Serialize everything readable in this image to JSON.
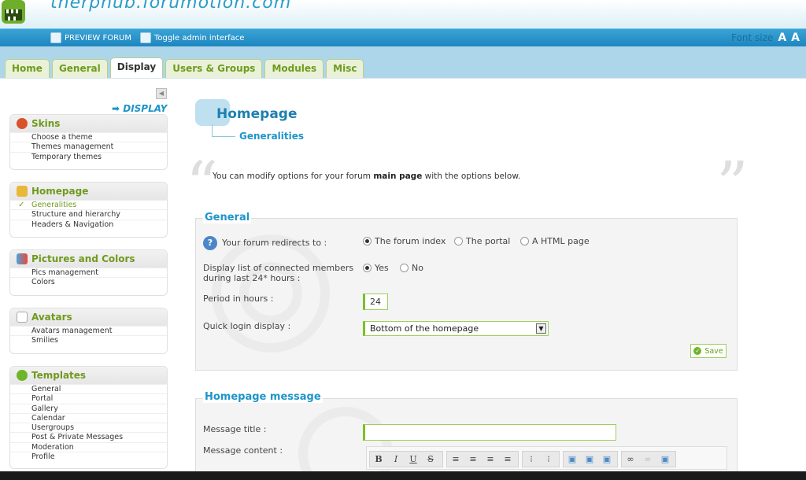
{
  "header": {
    "site_title": "therphub.forumotion.com",
    "preview_label": "PREVIEW FORUM",
    "toggle_label": "Toggle admin interface",
    "font_size_label": "Font size"
  },
  "tabs": [
    {
      "label": "Home"
    },
    {
      "label": "General"
    },
    {
      "label": "Display"
    },
    {
      "label": "Users & Groups"
    },
    {
      "label": "Modules"
    },
    {
      "label": "Misc"
    }
  ],
  "sidebar": {
    "section_label": "➡ DISPLAY",
    "skins": {
      "title": "Skins",
      "items": [
        "Choose a theme",
        "Themes management",
        "Temporary themes"
      ]
    },
    "homepage": {
      "title": "Homepage",
      "items": [
        "Generalities",
        "Structure and hierarchy",
        "Headers & Navigation"
      ]
    },
    "pictures": {
      "title": "Pictures and Colors",
      "items": [
        "Pics management",
        "Colors"
      ]
    },
    "avatars": {
      "title": "Avatars",
      "items": [
        "Avatars management",
        "Smilies"
      ]
    },
    "templates": {
      "title": "Templates",
      "items": [
        "General",
        "Portal",
        "Gallery",
        "Calendar",
        "Usergroups",
        "Post & Private Messages",
        "Moderation",
        "Profile"
      ]
    }
  },
  "main": {
    "title": "Homepage",
    "subtitle": "Generalities",
    "intro_pre": "You can modify options for your forum ",
    "intro_bold": "main page",
    "intro_post": " with the options below.",
    "general": {
      "title": "General",
      "redirect_label": "Your forum redirects to :",
      "redirect_options": [
        "The forum index",
        "The portal",
        "A HTML page"
      ],
      "connected_label_1": "Display list of connected members",
      "connected_label_2": "during last 24* hours :",
      "connected_options": [
        "Yes",
        "No"
      ],
      "period_label": "Period in hours :",
      "period_value": "24",
      "quick_login_label": "Quick login display :",
      "quick_login_value": "Bottom of the homepage",
      "save_label": "Save"
    },
    "message": {
      "title": "Homepage message",
      "title_label": "Message title :",
      "title_value": "",
      "content_label": "Message content :"
    }
  },
  "colors": {
    "accent_green": "#6f9a1e",
    "accent_blue": "#1e95c8",
    "admin_bar": "#2a94c9"
  }
}
